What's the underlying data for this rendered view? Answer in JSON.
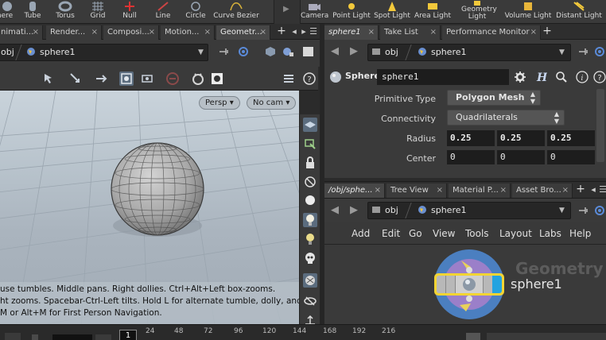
{
  "shelf": {
    "left_tools": [
      {
        "label": "here",
        "icon": "sphere-icon"
      },
      {
        "label": "Tube",
        "icon": "tube-icon"
      },
      {
        "label": "Torus",
        "icon": "torus-icon"
      },
      {
        "label": "Grid",
        "icon": "grid-icon"
      },
      {
        "label": "Null",
        "icon": "null-icon"
      },
      {
        "label": "Line",
        "icon": "line-icon"
      },
      {
        "label": "Circle",
        "icon": "circle-icon"
      },
      {
        "label": "Curve Bezier",
        "icon": "curve-bezier-icon"
      }
    ],
    "right_tools": [
      {
        "label": "Camera",
        "icon": "camera-icon"
      },
      {
        "label": "Point Light",
        "icon": "point-light-icon"
      },
      {
        "label": "Spot Light",
        "icon": "spot-light-icon"
      },
      {
        "label": "Area Light",
        "icon": "area-light-icon"
      },
      {
        "label": "Geometry Light",
        "icon": "geometry-light-icon"
      },
      {
        "label": "Volume Light",
        "icon": "volume-light-icon"
      },
      {
        "label": "Distant Light",
        "icon": "distant-light-icon"
      }
    ]
  },
  "left_tabs": [
    "nimati...",
    "Render...",
    "Composi...",
    "Motion...",
    "Geometr..."
  ],
  "right_tabs_top": [
    "sphere1",
    "Take List",
    "Performance Monitor"
  ],
  "right_tabs_bottom": [
    "/obj/sphe...",
    "Tree View",
    "Material P...",
    "Asset Bro..."
  ],
  "path": {
    "root": "obj",
    "node": "sphere1"
  },
  "viewer": {
    "persp_label": "Persp",
    "cam_label": "No cam",
    "help_lines": [
      "use tumbles. Middle pans. Right dollies. Ctrl+Alt+Left box-zooms.",
      "ht zooms. Spacebar-Ctrl-Left tilts. Hold L for alternate tumble, dolly, and",
      " M or Alt+M for First Person Navigation."
    ]
  },
  "params": {
    "node_type": "Sphere",
    "node_name": "sphere1",
    "primitive_type_label": "Primitive Type",
    "primitive_type_value": "Polygon Mesh",
    "connectivity_label": "Connectivity",
    "connectivity_value": "Quadrilaterals",
    "radius_label": "Radius",
    "radius": [
      "0.25",
      "0.25",
      "0.25"
    ],
    "center_label": "Center",
    "center": [
      "0",
      "0",
      "0"
    ]
  },
  "network": {
    "menu": [
      "Add",
      "Edit",
      "Go",
      "View",
      "Tools",
      "Layout",
      "Labs",
      "Help"
    ],
    "context_label": "Geometry",
    "node_label": "sphere1"
  },
  "timeline": {
    "current_frame": "1",
    "ticks": [
      "24",
      "48",
      "72",
      "96",
      "120",
      "144",
      "168",
      "192",
      "216"
    ]
  },
  "colors": {
    "shelf_bg": "#3a3a3a",
    "pane_bg": "#3a3a3a",
    "viewport_top": "#c9d3db",
    "node_ring": "#4b7fc0",
    "node_inner": "#9b7fc9",
    "node_selected": "#f2d433",
    "node_flag": "#22a3e0"
  }
}
